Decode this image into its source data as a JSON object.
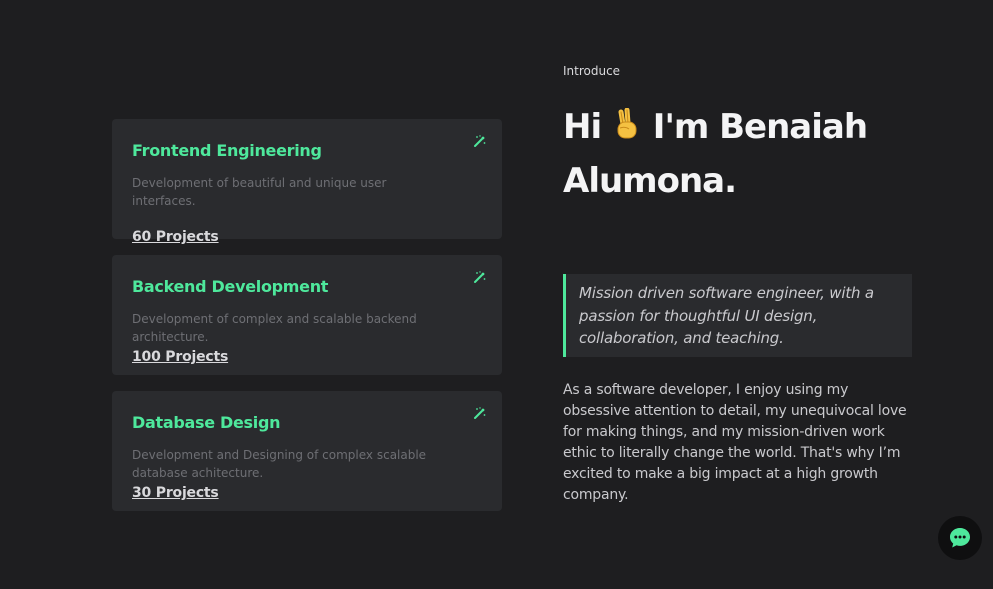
{
  "services": [
    {
      "title": "Frontend Engineering",
      "description": "Development of beautiful and unique user interfaces.",
      "projects": "60 Projects",
      "icon": "magic-wand-icon"
    },
    {
      "title": "Backend Development",
      "description": "Development of complex and scalable backend architecture.",
      "projects": "100 Projects",
      "icon": "magic-wand-icon"
    },
    {
      "title": "Database Design",
      "description": "Development and Designing of complex scalable database achitecture.",
      "projects": "30 Projects",
      "icon": "magic-wand-icon"
    }
  ],
  "intro": {
    "label": "Introduce",
    "greeting_before": "Hi",
    "greeting_after": "I'm Benaiah Alumona.",
    "emoji": "victory-hand-icon",
    "quote": "Mission driven software engineer, with a passion for thoughtful UI design, collaboration, and teaching.",
    "about": "As a software developer, I enjoy using my obsessive attention to detail, my unequivocal love for making things, and my mission-driven work ethic to literally change the world. That's why I’m excited to make a big impact at a high growth company."
  },
  "chat": {
    "icon": "chat-bubble-icon"
  },
  "colors": {
    "background": "#1e1e20",
    "card": "#2a2b2e",
    "accent": "#4ee89c",
    "text": "#f4f4f5",
    "muted": "#6e6f74"
  }
}
